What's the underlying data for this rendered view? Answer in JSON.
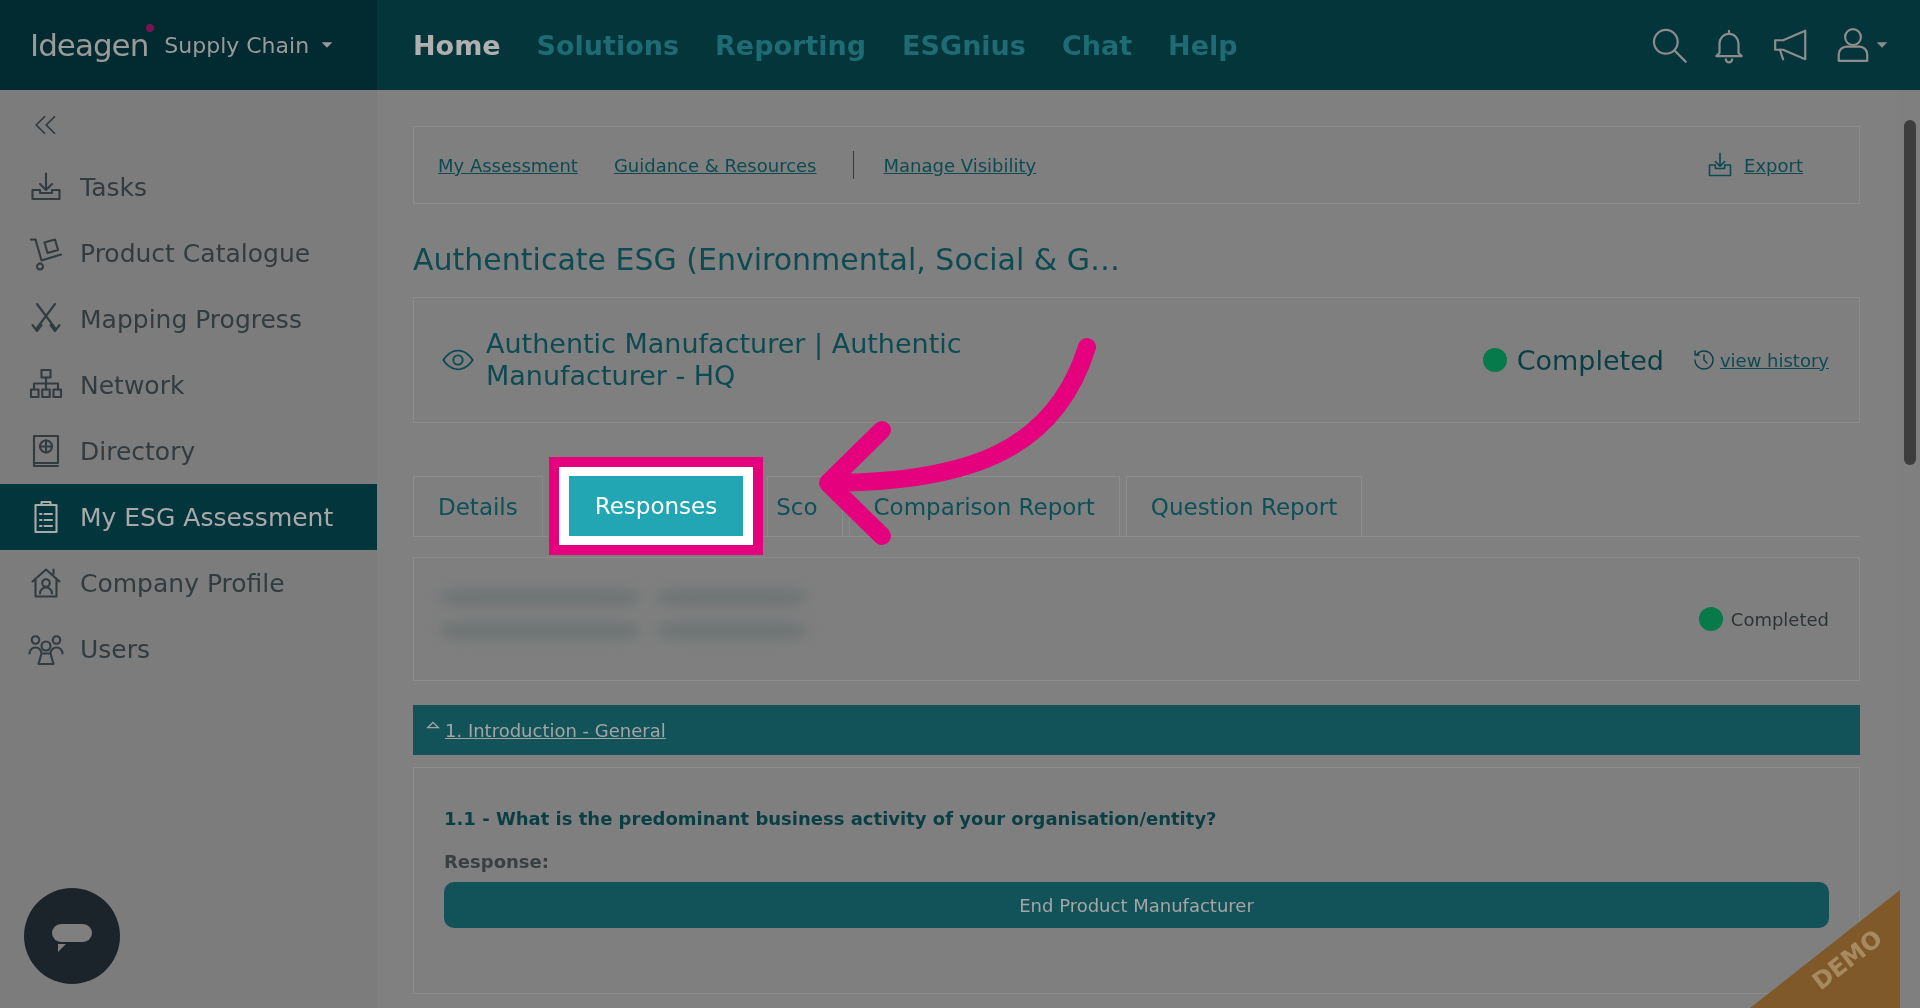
{
  "brand": {
    "logo": "Ideagen",
    "product": "Supply Chain"
  },
  "nav": [
    {
      "label": "Home",
      "selected": true
    },
    {
      "label": "Solutions",
      "selected": false
    },
    {
      "label": "Reporting",
      "selected": false
    },
    {
      "label": "ESGnius",
      "selected": false
    },
    {
      "label": "Chat",
      "selected": false
    },
    {
      "label": "Help",
      "selected": false
    }
  ],
  "sidebar": {
    "items": [
      {
        "label": "Tasks",
        "selected": false
      },
      {
        "label": "Product Catalogue",
        "selected": false
      },
      {
        "label": "Mapping Progress",
        "selected": false
      },
      {
        "label": "Network",
        "selected": false
      },
      {
        "label": "Directory",
        "selected": false
      },
      {
        "label": "My ESG Assessment",
        "selected": true
      },
      {
        "label": "Company Profile",
        "selected": false
      },
      {
        "label": "Users",
        "selected": false
      }
    ]
  },
  "links": [
    "My Assessment",
    "Guidance & Resources",
    "Manage Visibility"
  ],
  "export": "Export",
  "title": "Authenticate ESG (Environmental, Social & G…",
  "entity": {
    "name": "Authentic Manufacturer | Authentic Manufacturer - HQ",
    "status": "Completed",
    "history": "view history"
  },
  "tabs": [
    {
      "label": "Details",
      "selected": false
    },
    {
      "label": "Responses",
      "selected": true
    },
    {
      "label": "Sco",
      "selected": false
    },
    {
      "label": "Comparison Report",
      "selected": false
    },
    {
      "label": "Question Report",
      "selected": false
    }
  ],
  "summary": {
    "status": "Completed"
  },
  "section": {
    "title": "1. Introduction - General",
    "expanded": true
  },
  "question": {
    "text": "1.1 - What is the predominant business activity of your organisation/entity?",
    "response_label": "Response:",
    "response": "End Product Manufacturer"
  },
  "demo": "DEMO"
}
